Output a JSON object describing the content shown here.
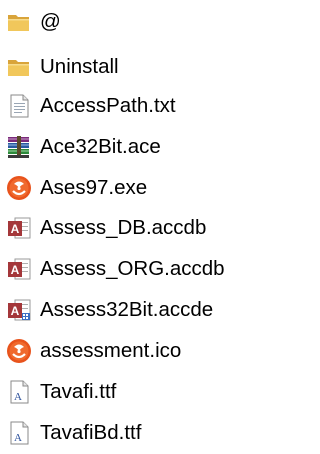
{
  "file_list": {
    "items": [
      {
        "name": "@",
        "icon": "folder-icon"
      },
      {
        "name": "Uninstall",
        "icon": "folder-icon"
      },
      {
        "name": "AccessPath.txt",
        "icon": "text-file-icon"
      },
      {
        "name": "Ace32Bit.ace",
        "icon": "archive-books-icon"
      },
      {
        "name": "Ases97.exe",
        "icon": "orange-logo-icon"
      },
      {
        "name": "Assess_DB.accdb",
        "icon": "access-database-icon"
      },
      {
        "name": "Assess_ORG.accdb",
        "icon": "access-database-icon"
      },
      {
        "name": "Assess32Bit.accde",
        "icon": "access-database-locked-icon"
      },
      {
        "name": "assessment.ico",
        "icon": "orange-logo-icon"
      },
      {
        "name": "Tavafi.ttf",
        "icon": "font-file-icon"
      },
      {
        "name": "TavafiBd.ttf",
        "icon": "font-file-icon"
      }
    ]
  },
  "colors": {
    "folder": "#e8b84a",
    "access": "#a4373a",
    "orange_logo": "#e8531c"
  }
}
